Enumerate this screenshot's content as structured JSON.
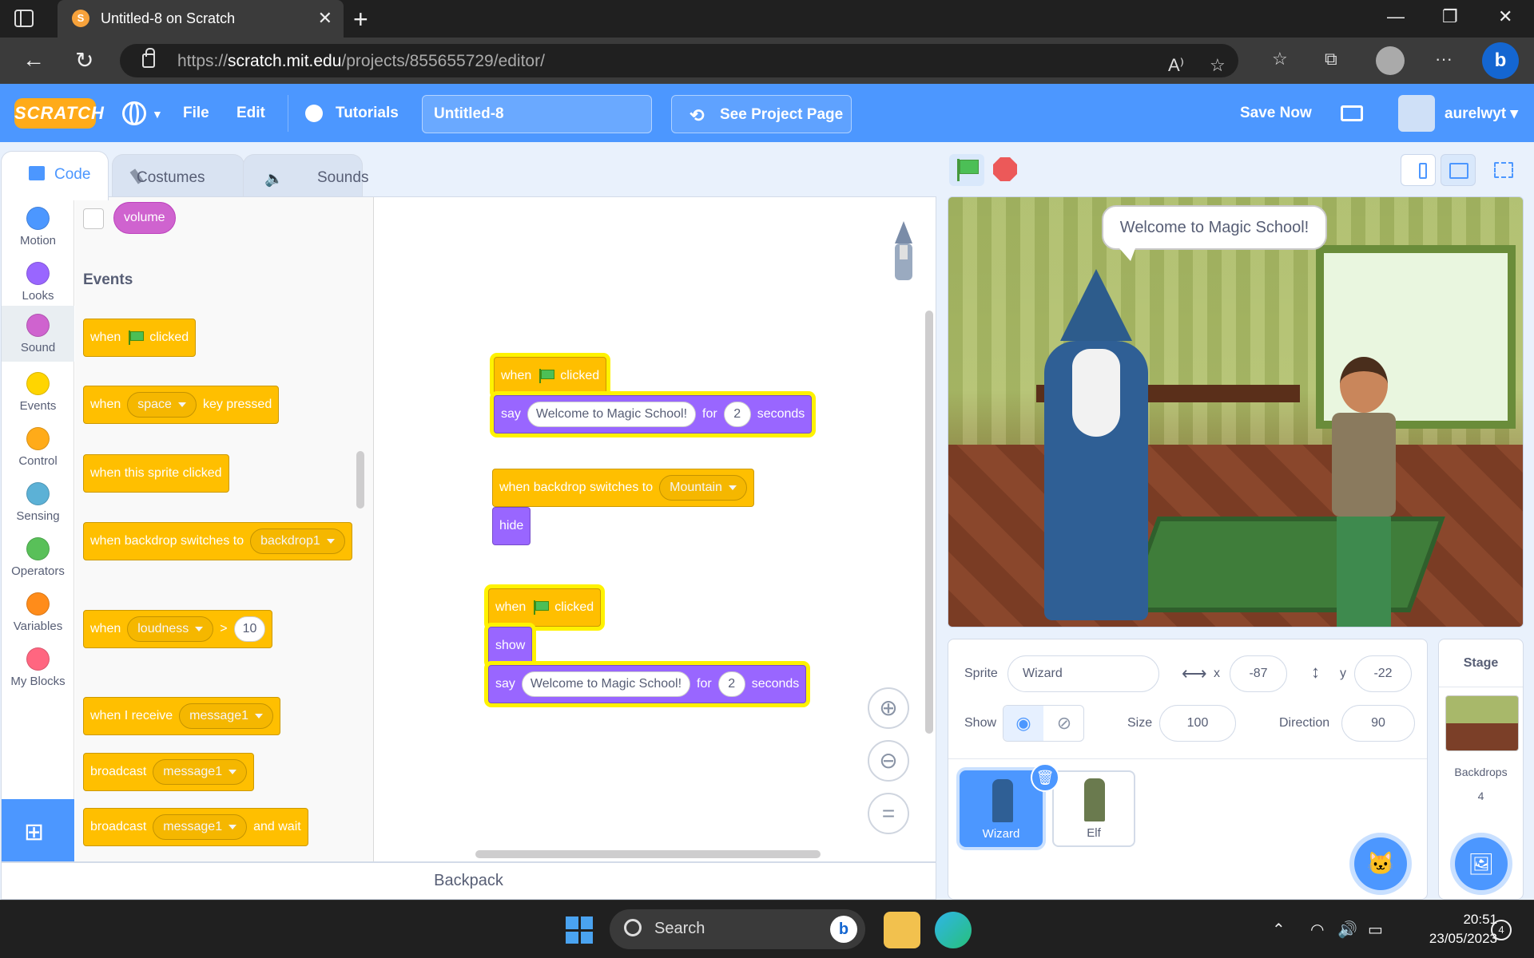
{
  "browser": {
    "tab_title": "Untitled-8 on Scratch",
    "favicon_letter": "S",
    "url_prefix": "https://",
    "url_host": "scratch.mit.edu",
    "url_path": "/projects/855655729/editor/"
  },
  "menubar": {
    "logo": "SCRATCH",
    "file": "File",
    "edit": "Edit",
    "tutorials": "Tutorials",
    "project_title": "Untitled-8",
    "see_project_page": "See Project Page",
    "save_now": "Save Now",
    "username": "aurelwyt"
  },
  "editor_tabs": {
    "code": "Code",
    "costumes": "Costumes",
    "sounds": "Sounds"
  },
  "categories": [
    {
      "label": "Motion",
      "color": "#4c97ff"
    },
    {
      "label": "Looks",
      "color": "#9966ff"
    },
    {
      "label": "Sound",
      "color": "#cf63cf"
    },
    {
      "label": "Events",
      "color": "#ffd500"
    },
    {
      "label": "Control",
      "color": "#ffab19"
    },
    {
      "label": "Sensing",
      "color": "#5cb1d6"
    },
    {
      "label": "Operators",
      "color": "#59c059"
    },
    {
      "label": "Variables",
      "color": "#ff8c1a"
    },
    {
      "label": "My Blocks",
      "color": "#ff6680"
    }
  ],
  "palette": {
    "volume_reporter": "volume",
    "section_events": "Events",
    "when": "when",
    "clicked": "clicked",
    "space": "space",
    "key_pressed": "key pressed",
    "when_this_sprite_clicked": "when this sprite clicked",
    "when_backdrop_switches_to": "when backdrop switches to",
    "backdrop1": "backdrop1",
    "loudness": "loudness",
    "gt": ">",
    "loudness_value": "10",
    "when_i_receive": "when I receive",
    "message1": "message1",
    "broadcast": "broadcast",
    "and_wait": "and wait"
  },
  "workspace": {
    "say": "say",
    "say_text": "Welcome to Magic School!",
    "for": "for",
    "seconds_value": "2",
    "seconds": "seconds",
    "backdrop_value": "Mountain",
    "hide": "hide",
    "show": "show"
  },
  "stage": {
    "speech_bubble": "Welcome to Magic School!"
  },
  "sprite_info": {
    "sprite_label": "Sprite",
    "sprite_name": "Wizard",
    "x_label": "x",
    "x_value": "-87",
    "y_label": "y",
    "y_value": "-22",
    "show_label": "Show",
    "size_label": "Size",
    "size_value": "100",
    "direction_label": "Direction",
    "direction_value": "90"
  },
  "sprites": [
    {
      "name": "Wizard",
      "selected": true
    },
    {
      "name": "Elf",
      "selected": false
    }
  ],
  "stage_panel": {
    "title": "Stage",
    "backdrops_label": "Backdrops",
    "backdrops_count": "4"
  },
  "backpack": "Backpack",
  "taskbar": {
    "search": "Search",
    "time": "20:51",
    "date": "23/05/2023",
    "notifications": "4"
  },
  "colors": {
    "scratch_blue": "#4c97ff",
    "events_yellow": "#ffbf00",
    "looks_purple": "#9966ff",
    "highlight": "#fff200"
  }
}
